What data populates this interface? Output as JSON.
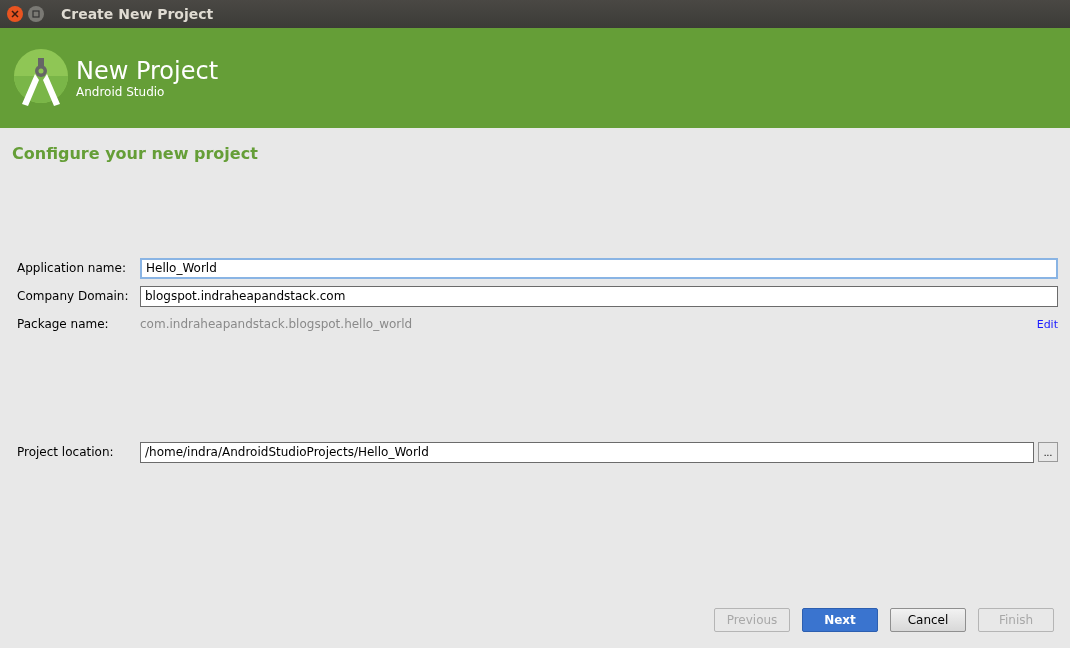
{
  "window": {
    "title": "Create New Project"
  },
  "header": {
    "title": "New Project",
    "subtitle": "Android Studio"
  },
  "section_title": "Configure your new project",
  "fields": [
    {
      "label": "Application name:",
      "value": "Hello_World",
      "focused": true
    },
    {
      "label": "Company Domain:",
      "value": "blogspot.indraheapandstack.com",
      "focused": false
    }
  ],
  "package": {
    "label": "Package name:",
    "value": "com.indraheapandstack.blogspot.hello_world",
    "link": "Edit"
  },
  "location": {
    "label": "Project location:",
    "value": "/home/indra/AndroidStudioProjects/Hello_World",
    "browse": "..."
  },
  "buttons": [
    {
      "label": "Previous",
      "disabled": true,
      "default": false
    },
    {
      "label": "Next",
      "disabled": false,
      "default": true
    },
    {
      "label": "Cancel",
      "disabled": false,
      "default": false
    },
    {
      "label": "Finish",
      "disabled": true,
      "default": false
    }
  ]
}
